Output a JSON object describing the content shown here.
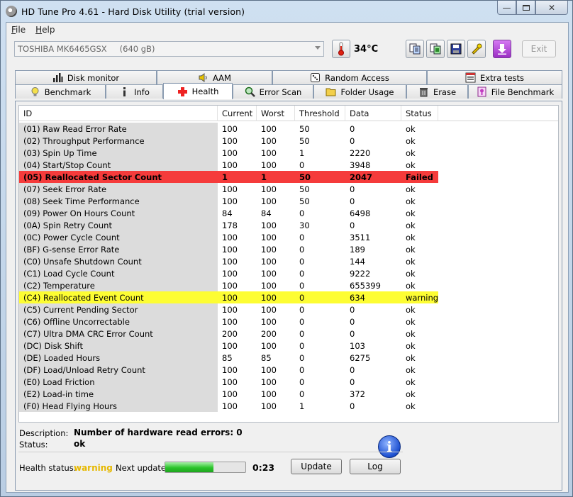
{
  "window": {
    "title": "HD Tune Pro 4.61 - Hard Disk Utility (trial version)"
  },
  "menu": [
    {
      "label": "File",
      "accel": "F",
      "rest": "ile"
    },
    {
      "label": "Help",
      "accel": "H",
      "rest": "elp"
    }
  ],
  "toolbar": {
    "drive_model": "TOSHIBA MK6465GSX",
    "drive_size": "(640 gB)",
    "temperature": "34°C",
    "exit_label": "Exit",
    "icons": [
      "copy-text-icon",
      "copy-screenshot-icon",
      "save-icon",
      "options-icon",
      "download-icon"
    ]
  },
  "tabs": {
    "top": [
      {
        "label": "Disk monitor",
        "icon": "disk-monitor-icon"
      },
      {
        "label": "AAM",
        "icon": "speaker-icon"
      },
      {
        "label": "Random Access",
        "icon": "dice-icon"
      },
      {
        "label": "Extra tests",
        "icon": "extra-tests-icon"
      }
    ],
    "bottom": [
      {
        "label": "Benchmark",
        "icon": "lightbulb-icon"
      },
      {
        "label": "Info",
        "icon": "info-icon"
      },
      {
        "label": "Health",
        "icon": "health-cross-icon",
        "active": true
      },
      {
        "label": "Error Scan",
        "icon": "magnifier-icon"
      },
      {
        "label": "Folder Usage",
        "icon": "folder-icon"
      },
      {
        "label": "Erase",
        "icon": "trash-icon"
      },
      {
        "label": "File Benchmark",
        "icon": "file-benchmark-icon"
      }
    ]
  },
  "table": {
    "headers": [
      "ID",
      "Current",
      "Worst",
      "Threshold",
      "Data",
      "Status"
    ],
    "rows": [
      {
        "id": "(01) Raw Read Error Rate",
        "current": "100",
        "worst": "100",
        "threshold": "50",
        "data": "0",
        "status": "ok"
      },
      {
        "id": "(02) Throughput Performance",
        "current": "100",
        "worst": "100",
        "threshold": "50",
        "data": "0",
        "status": "ok"
      },
      {
        "id": "(03) Spin Up Time",
        "current": "100",
        "worst": "100",
        "threshold": "1",
        "data": "2220",
        "status": "ok"
      },
      {
        "id": "(04) Start/Stop Count",
        "current": "100",
        "worst": "100",
        "threshold": "0",
        "data": "3948",
        "status": "ok"
      },
      {
        "id": "(05) Reallocated Sector Count",
        "current": "1",
        "worst": "1",
        "threshold": "50",
        "data": "2047",
        "status": "Failed",
        "state": "failed"
      },
      {
        "id": "(07) Seek Error Rate",
        "current": "100",
        "worst": "100",
        "threshold": "50",
        "data": "0",
        "status": "ok"
      },
      {
        "id": "(08) Seek Time Performance",
        "current": "100",
        "worst": "100",
        "threshold": "50",
        "data": "0",
        "status": "ok"
      },
      {
        "id": "(09) Power On Hours Count",
        "current": "84",
        "worst": "84",
        "threshold": "0",
        "data": "6498",
        "status": "ok"
      },
      {
        "id": "(0A) Spin Retry Count",
        "current": "178",
        "worst": "100",
        "threshold": "30",
        "data": "0",
        "status": "ok"
      },
      {
        "id": "(0C) Power Cycle Count",
        "current": "100",
        "worst": "100",
        "threshold": "0",
        "data": "3511",
        "status": "ok"
      },
      {
        "id": "(BF) G-sense Error Rate",
        "current": "100",
        "worst": "100",
        "threshold": "0",
        "data": "189",
        "status": "ok"
      },
      {
        "id": "(C0) Unsafe Shutdown Count",
        "current": "100",
        "worst": "100",
        "threshold": "0",
        "data": "144",
        "status": "ok"
      },
      {
        "id": "(C1) Load Cycle Count",
        "current": "100",
        "worst": "100",
        "threshold": "0",
        "data": "9222",
        "status": "ok"
      },
      {
        "id": "(C2) Temperature",
        "current": "100",
        "worst": "100",
        "threshold": "0",
        "data": "655399",
        "status": "ok"
      },
      {
        "id": "(C4) Reallocated Event Count",
        "current": "100",
        "worst": "100",
        "threshold": "0",
        "data": "634",
        "status": "warning",
        "state": "warning"
      },
      {
        "id": "(C5) Current Pending Sector",
        "current": "100",
        "worst": "100",
        "threshold": "0",
        "data": "0",
        "status": "ok"
      },
      {
        "id": "(C6) Offline Uncorrectable",
        "current": "100",
        "worst": "100",
        "threshold": "0",
        "data": "0",
        "status": "ok"
      },
      {
        "id": "(C7) Ultra DMA CRC Error Count",
        "current": "200",
        "worst": "200",
        "threshold": "0",
        "data": "0",
        "status": "ok"
      },
      {
        "id": "(DC) Disk Shift",
        "current": "100",
        "worst": "100",
        "threshold": "0",
        "data": "103",
        "status": "ok"
      },
      {
        "id": "(DE) Loaded Hours",
        "current": "85",
        "worst": "85",
        "threshold": "0",
        "data": "6275",
        "status": "ok"
      },
      {
        "id": "(DF) Load/Unload Retry Count",
        "current": "100",
        "worst": "100",
        "threshold": "0",
        "data": "0",
        "status": "ok"
      },
      {
        "id": "(E0) Load Friction",
        "current": "100",
        "worst": "100",
        "threshold": "0",
        "data": "0",
        "status": "ok"
      },
      {
        "id": "(E2) Load-in time",
        "current": "100",
        "worst": "100",
        "threshold": "0",
        "data": "372",
        "status": "ok"
      },
      {
        "id": "(F0) Head Flying Hours",
        "current": "100",
        "worst": "100",
        "threshold": "1",
        "data": "0",
        "status": "ok"
      }
    ]
  },
  "details": {
    "description_label": "Description:",
    "description_value": "Number of hardware read errors: 0",
    "status_label": "Status:",
    "status_value": "ok"
  },
  "footer": {
    "health_label": "Health status:",
    "health_value": "warning",
    "next_update_label": "Next update:",
    "next_update_progress": 0.6,
    "time_value": "0:23",
    "update_button": "Update",
    "log_button": "Log"
  },
  "colors": {
    "failed_row": "#f53b3b",
    "warning_row": "#fdfd33",
    "health_warning_text": "#e6b800",
    "progress_green": "#2bc42b"
  }
}
